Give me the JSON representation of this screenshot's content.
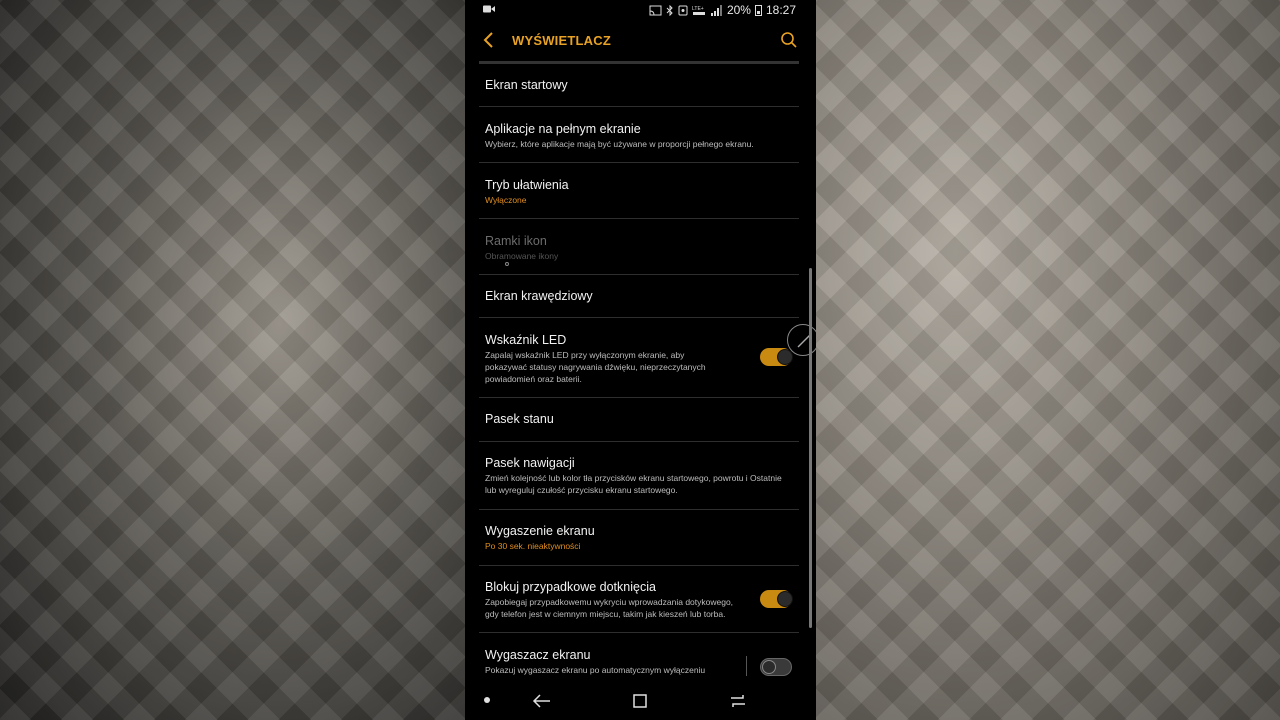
{
  "statusbar": {
    "battery": "20%",
    "time": "18:27",
    "icons": [
      "video-icon",
      "cast-icon",
      "bluetooth-icon",
      "nfc-icon",
      "lte-icon",
      "signal-icon",
      "battery-icon"
    ]
  },
  "appbar": {
    "title": "WYŚWIETLACZ",
    "back_icon": "chevron-left-icon",
    "search_icon": "search-icon"
  },
  "colors": {
    "accent": "#e8a225",
    "subtitle_accent": "#e08e1f",
    "toggle_on": "#c98a12",
    "background": "#000000"
  },
  "items": [
    {
      "title": "Ekran startowy"
    },
    {
      "title": "Aplikacje na pełnym ekranie",
      "subtitle": "Wybierz, które aplikacje mają być używane w proporcji pełnego ekranu."
    },
    {
      "title": "Tryb ułatwienia",
      "subtitle": "Wyłączone"
    },
    {
      "title": "Ramki ikon",
      "subtitle": "Obramowane ikony"
    },
    {
      "title": "Ekran krawędziowy"
    },
    {
      "title": "Wskaźnik LED",
      "subtitle_lines": [
        "Zapalaj wskaźnik LED przy wyłączonym ekranie, aby",
        "pokazywać statusy nagrywania dźwięku, nieprzeczytanych",
        "powiadomień oraz baterii."
      ],
      "toggle": "on"
    },
    {
      "title": "Pasek stanu"
    },
    {
      "title": "Pasek nawigacji",
      "subtitle_lines": [
        "Zmień kolejność lub kolor tła przycisków ekranu startowego, powrotu i Ostatnie",
        "lub wyreguluj czułość przycisku ekranu startowego."
      ]
    },
    {
      "title": "Wygaszenie ekranu",
      "subtitle": "Po 30 sek. nieaktywności"
    },
    {
      "title": "Blokuj przypadkowe dotknięcia",
      "subtitle_lines": [
        "Zapobiegaj przypadkowemu wykryciu wprowadzania dotykowego,",
        "gdy telefon jest w ciemnym miejscu, takim jak kieszeń lub torba."
      ],
      "toggle": "on"
    },
    {
      "title": "Wygaszacz ekranu",
      "subtitle": "Pokazuj wygaszacz ekranu po automatycznym wyłączeniu",
      "toggle": "off"
    }
  ],
  "navbar": {
    "buttons": [
      "back-icon",
      "home-icon",
      "recents-icon"
    ]
  }
}
